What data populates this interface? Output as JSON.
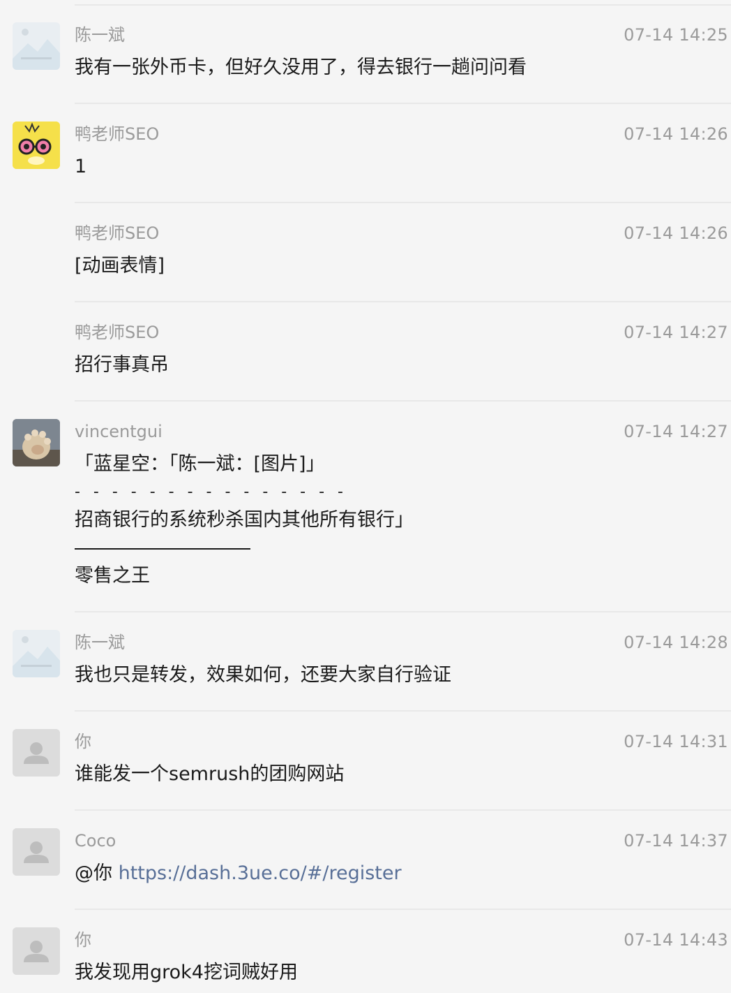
{
  "messages": [
    {
      "sender": "陈一斌",
      "time": "07-14 14:25",
      "text": "我有一张外币卡，但好久没用了，得去银行一趟问问看",
      "avatar": "landscape-placeholder-icon"
    },
    {
      "sender": "鸭老师SEO",
      "time": "07-14 14:26",
      "text": "1",
      "avatar": "duck-cartoon-avatar"
    },
    {
      "sender": "鸭老师SEO",
      "time": "07-14 14:26",
      "text": "[动画表情]"
    },
    {
      "sender": "鸭老师SEO",
      "time": "07-14 14:27",
      "text": "招行事真吊"
    },
    {
      "sender": "vincentgui",
      "time": "07-14 14:27",
      "quote_line1": "「蓝星空：「陈一斌：[图片]」",
      "dash": "- - - - - - - - - - - - - - -",
      "quote_line2": "招商银行的系统秒杀国内其他所有银行」",
      "reply": "零售之王",
      "avatar": "cat-paw-photo-avatar"
    },
    {
      "sender": "陈一斌",
      "time": "07-14 14:28",
      "text": "我也只是转发，效果如何，还要大家自行验证",
      "avatar": "landscape-placeholder-icon"
    },
    {
      "sender": "你",
      "time": "07-14 14:31",
      "text": "谁能发一个semrush的团购网站",
      "avatar": "default-user-icon"
    },
    {
      "sender": "Coco",
      "time": "07-14 14:37",
      "mention": "@你 ",
      "link": "https://dash.3ue.co/#/register",
      "avatar": "default-user-icon"
    },
    {
      "sender": "你",
      "time": "07-14 14:43",
      "text": "我发现用grok4挖词贼好用",
      "avatar": "default-user-icon"
    }
  ],
  "colors": {
    "background": "#f5f5f5",
    "meta_text": "#9a9a9a",
    "body_text": "#1a1a1a",
    "link": "#586f97",
    "separator": "#e8e8e8"
  }
}
